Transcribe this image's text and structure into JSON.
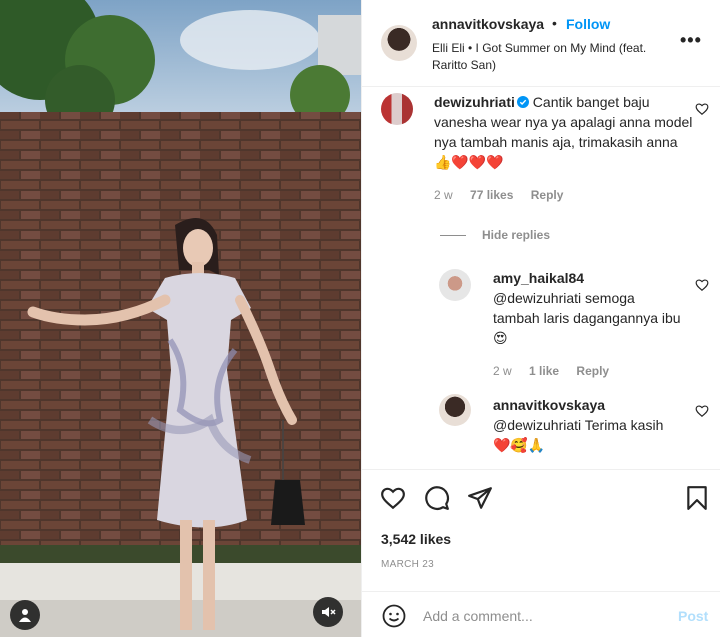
{
  "post": {
    "username": "annavitkovskaya",
    "separator": "•",
    "follow_label": "Follow",
    "audio": "Elli Eli • I Got Summer on My Mind (feat. Raritto San)",
    "more_label": "•••"
  },
  "comments": [
    {
      "username": "dewizuhriati",
      "verified": true,
      "text": "Cantik banget baju vanesha wear nya ya apalagi anna model nya tambah manis aja, trimakasih anna",
      "emojis": "👍❤️❤️❤️",
      "age": "2 w",
      "likes": "77 likes",
      "reply_label": "Reply"
    }
  ],
  "hide_replies_label": "Hide replies",
  "replies": [
    {
      "username": "amy_haikal84",
      "text": "@dewizuhriati semoga tambah laris dagangannya ibu",
      "emojis": "😍",
      "age": "2 w",
      "likes": "1 like",
      "reply_label": "Reply"
    },
    {
      "username": "annavitkovskaya",
      "text": "@dewizuhriati Terima kasih",
      "emojis": "❤️🥰🙏",
      "age": "",
      "likes": "",
      "reply_label": ""
    }
  ],
  "stats": {
    "likes": "3,542 likes",
    "date": "MARCH 23"
  },
  "composer": {
    "placeholder": "Add a comment...",
    "post_label": "Post"
  },
  "icons": {
    "like": "heart-icon",
    "comment": "comment-icon",
    "share": "paper-plane-icon",
    "save": "bookmark-icon",
    "emoji": "smiley-icon",
    "mute": "speaker-muted-icon",
    "tag": "user-tag-icon"
  },
  "colors": {
    "link": "#0095f6",
    "muted": "#8e8e8e",
    "post_disabled": "#b2dffc",
    "heart": "#e0182b"
  }
}
